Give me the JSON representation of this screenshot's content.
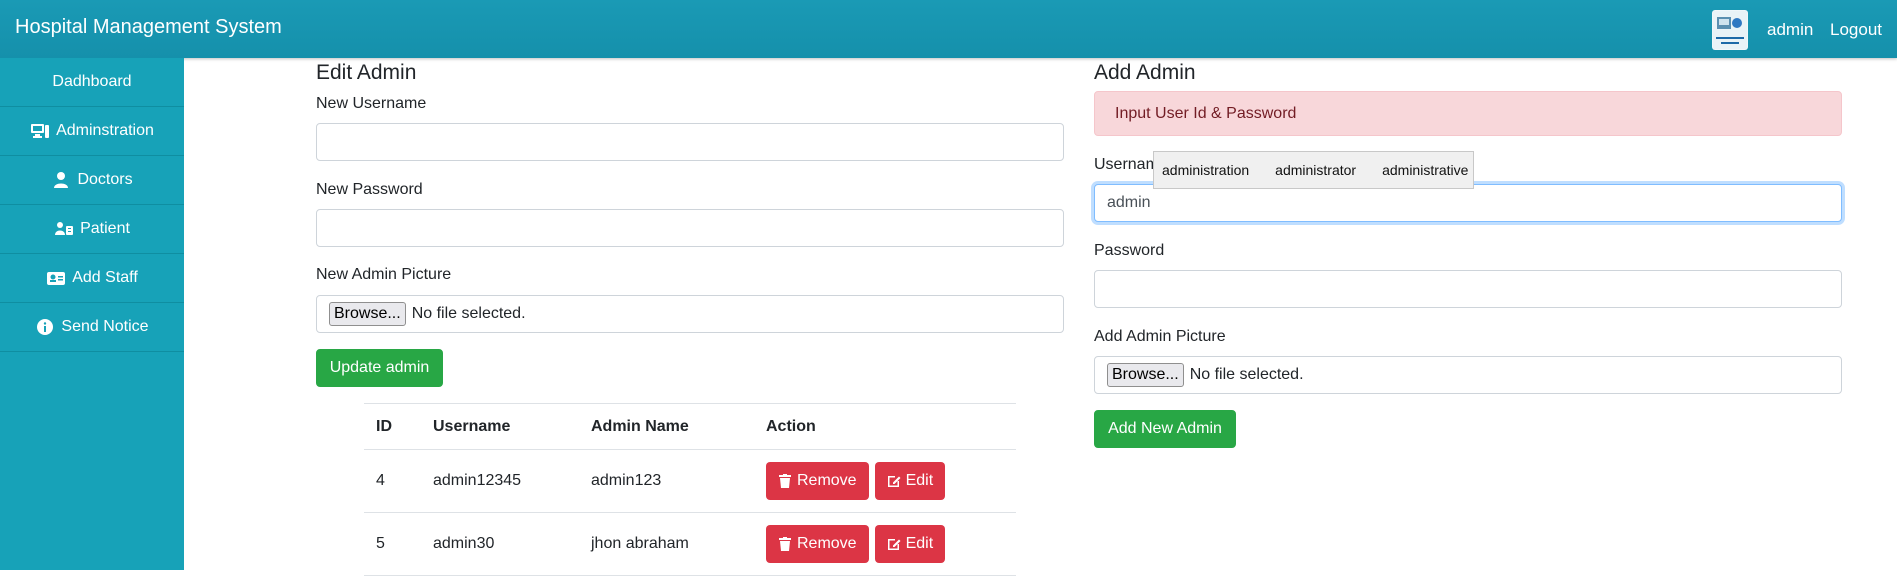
{
  "app": {
    "title": "Hospital Management System"
  },
  "topbar": {
    "username": "admin",
    "logout_label": "Logout"
  },
  "sidebar": {
    "items": [
      {
        "label": "Dadhboard",
        "icon": "none"
      },
      {
        "label": "Adminstration",
        "icon": "desktop-icon"
      },
      {
        "label": "Doctors",
        "icon": "user-icon"
      },
      {
        "label": "Patient",
        "icon": "patient-icon"
      },
      {
        "label": "Add Staff",
        "icon": "id-card-icon"
      },
      {
        "label": "Send Notice",
        "icon": "info-circle-icon"
      }
    ]
  },
  "edit_admin": {
    "heading": "Edit Admin",
    "username_label": "New Username",
    "username_value": "",
    "password_label": "New Password",
    "password_value": "",
    "picture_label": "New Admin Picture",
    "browse_label": "Browse...",
    "file_status": "No file selected.",
    "submit_label": "Update admin"
  },
  "table": {
    "headers": [
      "ID",
      "Username",
      "Admin Name",
      "Action"
    ],
    "rows": [
      {
        "id": "4",
        "username": "admin12345",
        "admin_name": "admin123",
        "remove": "Remove",
        "edit": "Edit"
      },
      {
        "id": "5",
        "username": "admin30",
        "admin_name": "jhon abraham",
        "remove": "Remove",
        "edit": "Edit"
      }
    ]
  },
  "add_admin": {
    "heading": "Add Admin",
    "alert": "Input User Id & Password",
    "username_label": "Usernam",
    "username_value": "admin",
    "autocomplete": [
      "administration",
      "administrator",
      "administrative"
    ],
    "password_label": "Password",
    "password_value": "",
    "picture_label": "Add Admin Picture",
    "browse_label": "Browse...",
    "file_status": "No file selected.",
    "submit_label": "Add New Admin"
  },
  "colors": {
    "topbar": "#1a9ab5",
    "sidebar": "#17a2b8",
    "success": "#28a745",
    "danger": "#dc3545",
    "alert_bg": "#f8d7da"
  }
}
